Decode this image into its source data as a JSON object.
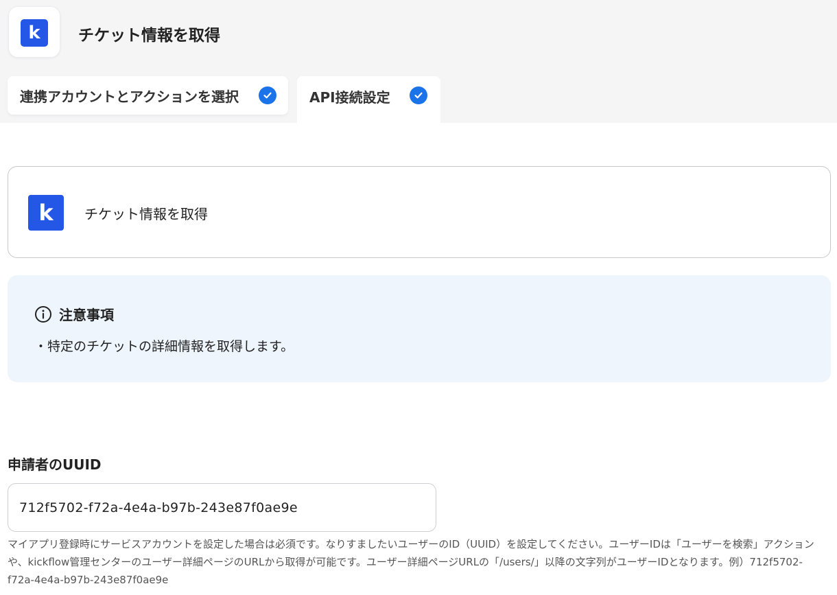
{
  "header": {
    "app_logo_letter": "k",
    "title": "チケット情報を取得"
  },
  "tabs": [
    {
      "label": "連携アカウントとアクションを選択",
      "completed": true
    },
    {
      "label": "API接続設定",
      "completed": true,
      "active": true
    }
  ],
  "action_card": {
    "logo_letter": "k",
    "title": "チケット情報を取得"
  },
  "notice": {
    "heading": "注意事項",
    "body": "・特定のチケットの詳細情報を取得します。"
  },
  "field": {
    "label": "申請者のUUID",
    "value": "712f5702-f72a-4e4a-b97b-243e87f0ae9e",
    "help": "マイアプリ登録時にサービスアカウントを設定した場合は必須です。なりすましたいユーザーのID（UUID）を設定してください。ユーザーIDは「ユーザーを検索」アクションや、kickflow管理センターのユーザー詳細ページのURLから取得が可能です。ユーザー詳細ページURLの「/users/」以降の文字列がユーザーIDとなります。例）712f5702-f72a-4e4a-b97b-243e87f0ae9e"
  },
  "colors": {
    "brand": "#2457e6",
    "check": "#1a73e8",
    "notice_bg": "#eef5fd"
  }
}
